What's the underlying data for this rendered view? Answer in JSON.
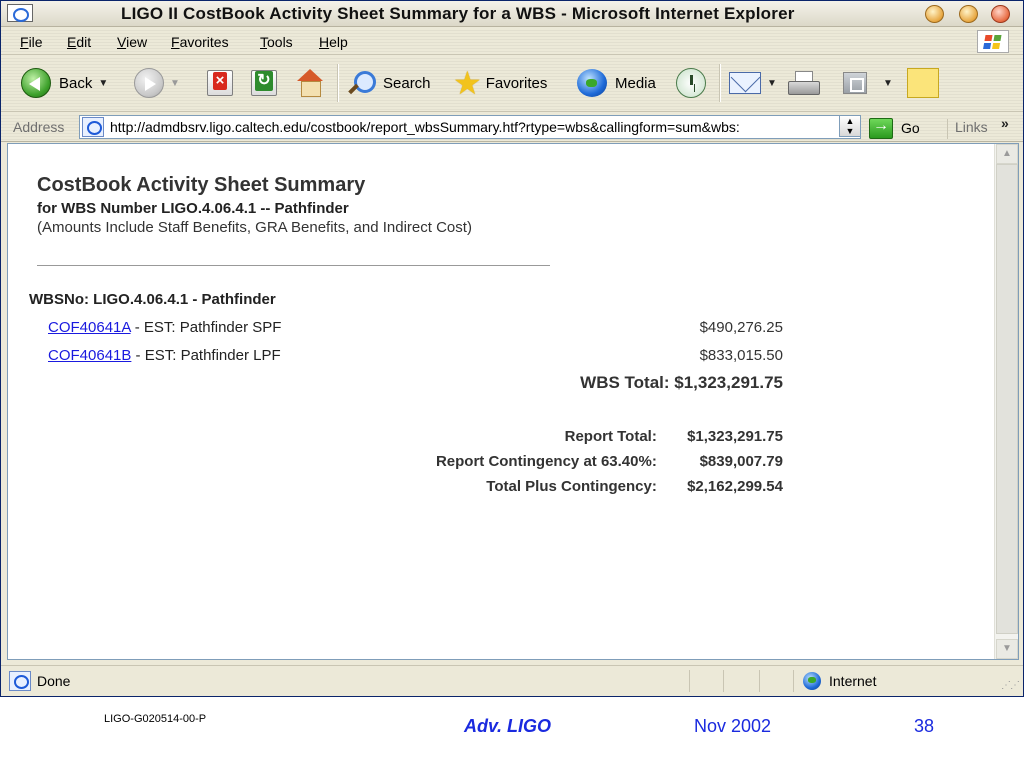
{
  "window": {
    "title": "LIGO II CostBook Activity Sheet Summary for a WBS - Microsoft Internet Explorer"
  },
  "menu": [
    "File",
    "Edit",
    "View",
    "Favorites",
    "Tools",
    "Help"
  ],
  "toolbar": {
    "back_label": "Back",
    "search_label": "Search",
    "favorites_label": "Favorites",
    "media_label": "Media"
  },
  "address": {
    "label": "Address",
    "url": "http://admdbsrv.ligo.caltech.edu/costbook/report_wbsSummary.htf?rtype=wbs&callingform=sum&wbs:",
    "go_label": "Go",
    "links_label": "Links"
  },
  "page": {
    "title": "CostBook Activity Sheet Summary",
    "subtitle": "for WBS Number LIGO.4.06.4.1 -- Pathfinder",
    "note": "(Amounts Include Staff Benefits, GRA Benefits, and Indirect Cost)",
    "wbs_heading": "WBSNo: LIGO.4.06.4.1 - Pathfinder",
    "items": [
      {
        "code": "COF40641A",
        "description": " - EST: Pathfinder SPF",
        "amount": "$490,276.25"
      },
      {
        "code": "COF40641B",
        "description": " - EST: Pathfinder LPF",
        "amount": "$833,015.50"
      }
    ],
    "wbs_total": "WBS Total: $1,323,291.75",
    "summary": [
      {
        "label": "Report Total:",
        "value": "$1,323,291.75"
      },
      {
        "label": "Report Contingency at 63.40%:",
        "value": "$839,007.79"
      },
      {
        "label": "Total Plus Contingency:",
        "value": "$2,162,299.54"
      }
    ]
  },
  "status": {
    "text": "Done",
    "zone": "Internet"
  },
  "footer": {
    "doc_id": "LIGO-G020514-00-P",
    "center": "Adv. LIGO",
    "date": "Nov 2002",
    "page": "38"
  }
}
